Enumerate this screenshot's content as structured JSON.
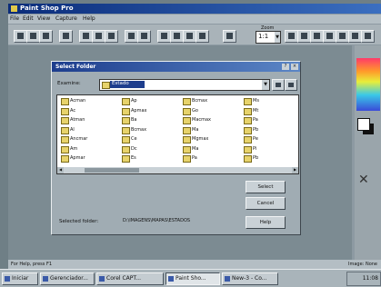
{
  "app": {
    "title": "Paint Shop Pro",
    "menu": [
      "File",
      "Edit",
      "View",
      "Capture",
      "Help"
    ],
    "zoom_label": "Zoom",
    "zoom_value": "1:1",
    "status_left": "For Help, press F1",
    "status_right": "Image: None"
  },
  "dialog": {
    "title": "Select Folder",
    "examine_label": "Examine:",
    "examine_value": "Estado",
    "folders": [
      "Acman",
      "Ac",
      "Atman",
      "Al",
      "Ancmar",
      "Am",
      "Apmar",
      "Ap",
      "Apmax",
      "Ba",
      "Bcmax",
      "Ce",
      "Dc",
      "Es",
      "Bcmax",
      "Go",
      "Macmax",
      "Ma",
      "Mgmax",
      "Ma",
      "Pa",
      "Ms",
      "Mt",
      "Pa",
      "Pb",
      "Pe",
      "Pi",
      "Pb"
    ],
    "select_button": "Select",
    "cancel_button": "Cancel",
    "help_button": "Help",
    "selected_label": "Selected folder:",
    "selected_path": "D:\\IMAGENS\\MAPAS\\ESTADOS"
  },
  "taskbar": {
    "start": "Iniciar",
    "tasks": [
      "Gerenciador...",
      "Corel CAPT...",
      "Paint Sho...",
      "New-3 - Co..."
    ],
    "clock": "11:08"
  }
}
